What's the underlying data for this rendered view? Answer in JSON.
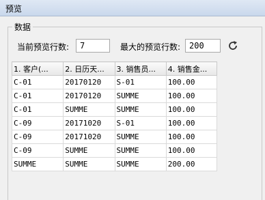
{
  "window": {
    "title": "预览"
  },
  "group": {
    "label": "数据"
  },
  "controls": {
    "current_rows_label": "当前预览行数:",
    "current_rows_value": "7",
    "max_rows_label": "最大的预览行数:",
    "max_rows_value": "200",
    "refresh_icon": "refresh-icon"
  },
  "table": {
    "headers": [
      "1. 客户(...",
      "2. 日历天...",
      "3. 销售员...",
      "4. 销售金..."
    ],
    "rows": [
      [
        "C-01",
        "20170120",
        "S-01",
        "100.00"
      ],
      [
        "C-01",
        "20170120",
        "SUMME",
        "100.00"
      ],
      [
        "C-01",
        "SUMME",
        "SUMME",
        "100.00"
      ],
      [
        "C-09",
        "20171020",
        "S-01",
        "100.00"
      ],
      [
        "C-09",
        "20171020",
        "SUMME",
        "100.00"
      ],
      [
        "C-09",
        "SUMME",
        "SUMME",
        "100.00"
      ],
      [
        "SUMME",
        "SUMME",
        "SUMME",
        "200.00"
      ]
    ]
  }
}
